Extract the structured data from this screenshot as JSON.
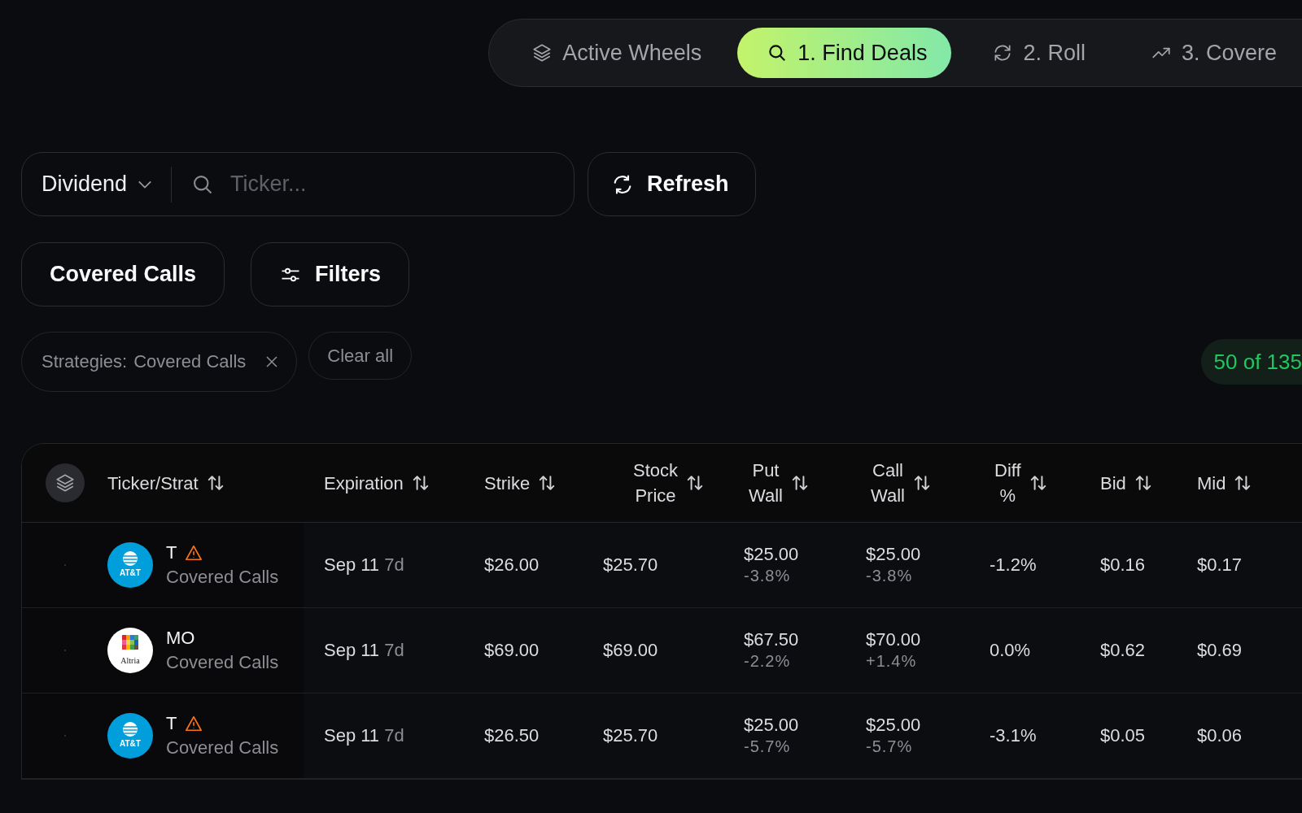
{
  "nav": {
    "tabs": [
      {
        "label": "Active Wheels",
        "kind": "layers",
        "selected": false
      },
      {
        "label": "1. Find Deals",
        "kind": "search",
        "selected": true
      },
      {
        "label": "2. Roll",
        "kind": "roll",
        "selected": false
      },
      {
        "label": "3. Covere",
        "kind": "trend",
        "selected": false
      }
    ]
  },
  "search": {
    "category": "Dividend",
    "placeholder": "Ticker..."
  },
  "refresh_button": "Refresh",
  "strategy_button": "Covered Calls",
  "filters_button": "Filters",
  "active_filters": [
    {
      "label": "Strategies:",
      "value": "Covered Calls"
    }
  ],
  "clear_all": "Clear all",
  "result_count": "50 of 135",
  "table": {
    "columns": [
      "Ticker/Strat",
      "Expiration",
      "Strike",
      "Stock Price",
      "Put Wall",
      "Call Wall",
      "Diff %",
      "Bid",
      "Mid"
    ],
    "rows": [
      {
        "kind": "att",
        "logo_text": "AT&T",
        "ticker": "T",
        "warning": true,
        "strategy": "Covered Calls",
        "exp_date": "Sep 11",
        "exp_days": "7d",
        "strike": "$26.00",
        "stock_price": "$25.70",
        "put_wall": "$25.00",
        "put_wall_pct": "-3.8%",
        "call_wall": "$25.00",
        "call_wall_pct": "-3.8%",
        "diff": "-1.2%",
        "bid": "$0.16",
        "mid": "$0.17"
      },
      {
        "kind": "altria",
        "logo_text": "Altria",
        "ticker": "MO",
        "warning": false,
        "strategy": "Covered Calls",
        "exp_date": "Sep 11",
        "exp_days": "7d",
        "strike": "$69.00",
        "stock_price": "$69.00",
        "put_wall": "$67.50",
        "put_wall_pct": "-2.2%",
        "call_wall": "$70.00",
        "call_wall_pct": "+1.4%",
        "diff": "0.0%",
        "bid": "$0.62",
        "mid": "$0.69"
      },
      {
        "kind": "att",
        "logo_text": "AT&T",
        "ticker": "T",
        "warning": true,
        "strategy": "Covered Calls",
        "exp_date": "Sep 11",
        "exp_days": "7d",
        "strike": "$26.50",
        "stock_price": "$25.70",
        "put_wall": "$25.00",
        "put_wall_pct": "-5.7%",
        "call_wall": "$25.00",
        "call_wall_pct": "-5.7%",
        "diff": "-3.1%",
        "bid": "$0.05",
        "mid": "$0.06"
      }
    ]
  }
}
